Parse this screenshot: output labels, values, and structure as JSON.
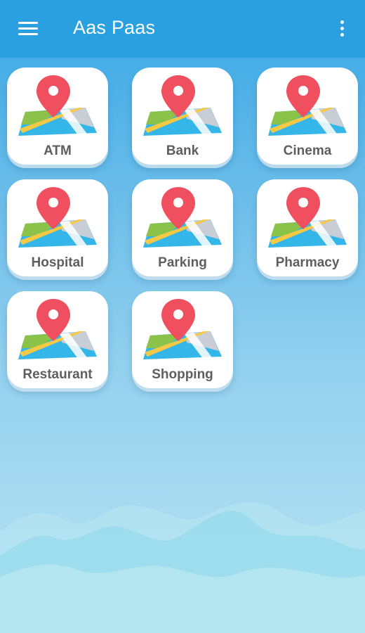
{
  "app": {
    "title": "Aas Paas"
  },
  "categories": [
    {
      "label": "ATM",
      "icon": "map-pin-icon"
    },
    {
      "label": "Bank",
      "icon": "map-pin-icon"
    },
    {
      "label": "Cinema",
      "icon": "map-pin-icon"
    },
    {
      "label": "Hospital",
      "icon": "map-pin-icon"
    },
    {
      "label": "Parking",
      "icon": "map-pin-icon"
    },
    {
      "label": "Pharmacy",
      "icon": "map-pin-icon"
    },
    {
      "label": "Restaurant",
      "icon": "map-pin-icon"
    },
    {
      "label": "Shopping",
      "icon": "map-pin-icon"
    }
  ],
  "colors": {
    "appbar": "#2aa0e0",
    "pin": "#ef4f5f",
    "map_green": "#8bc34a",
    "map_blue": "#35b6e8",
    "map_grey": "#c9ced6",
    "road_yellow": "#f6c945",
    "label": "#5e5e5e"
  }
}
